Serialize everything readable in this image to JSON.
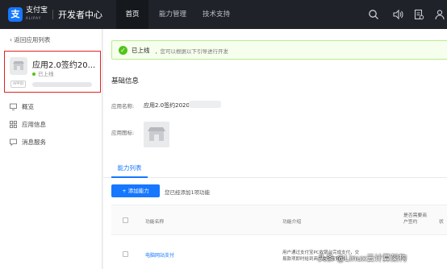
{
  "header": {
    "logo_mark": "支",
    "logo_cn": "支付宝",
    "logo_en": "ALIPAY",
    "title": "开发者中心",
    "tabs": [
      {
        "label": "首页",
        "active": true
      },
      {
        "label": "能力管理",
        "active": false
      },
      {
        "label": "技术支持",
        "active": false
      }
    ],
    "icons": [
      "search-icon",
      "volume-icon",
      "document-icon",
      "user-icon"
    ]
  },
  "sidebar": {
    "back_label": "返回应用列表",
    "app": {
      "name": "应用2.0签约20...",
      "status": "已上线",
      "tag": "APPID"
    },
    "items": [
      {
        "label": "概览",
        "icon": "monitor-icon"
      },
      {
        "label": "应用信息",
        "icon": "grid-icon"
      },
      {
        "label": "消息服务",
        "icon": "message-icon"
      }
    ]
  },
  "main": {
    "alert": {
      "title": "已上线",
      "text": "，您可以根据以下引导进行开发"
    },
    "basic_info": {
      "title": "基础信息",
      "name_label": "应用名称:",
      "name_value": "应用2.0签约20200",
      "icon_label": "应用图标:"
    },
    "tab_label": "能力列表",
    "add_button": "+ 添加能力",
    "add_hint": "您已经添加1项功能",
    "table": {
      "headers": [
        "功能名称",
        "功能介绍",
        "是否需要商户签约",
        "状"
      ],
      "rows": [
        {
          "name": "电脑网站支付",
          "desc": "用户通过支付宝PC收银台完成支付，交易款项即时给到商户支付宝账户。"
        }
      ]
    }
  },
  "watermark": "头条 @Linux云计算架构",
  "colors": {
    "nav_bg": "#1f2329",
    "accent": "#1677ff",
    "success": "#52c41a",
    "highlight_border": "#e02424"
  }
}
